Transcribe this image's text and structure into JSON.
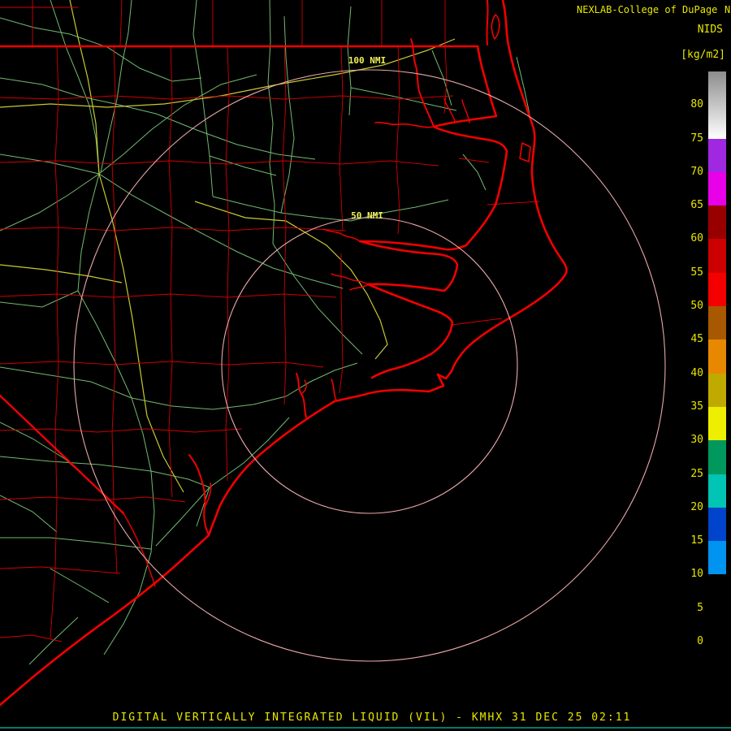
{
  "header": {
    "brand": "NEXLAB-College of DuPage",
    "brand_clip": "N",
    "scale_title": "NIDS",
    "scale_units": "[kg/m2]"
  },
  "range_rings": [
    {
      "label": "100 NMI"
    },
    {
      "label": "50 NMI"
    }
  ],
  "colorbar": {
    "min_value": 0,
    "max_value": 85,
    "tick_step": 5,
    "tick_labels": [
      "80",
      "75",
      "70",
      "65",
      "60",
      "55",
      "50",
      "45",
      "40",
      "35",
      "30",
      "25",
      "20",
      "15",
      "10",
      "5",
      "0"
    ],
    "segments": [
      {
        "from": 75,
        "to": 85,
        "color": "#8c8c8c",
        "color2": "#ffffff"
      },
      {
        "from": 70,
        "to": 75,
        "color": "#a028e0"
      },
      {
        "from": 65,
        "to": 70,
        "color": "#e800e8"
      },
      {
        "from": 60,
        "to": 65,
        "color": "#980000"
      },
      {
        "from": 55,
        "to": 60,
        "color": "#cc0000"
      },
      {
        "from": 50,
        "to": 55,
        "color": "#f40000"
      },
      {
        "from": 45,
        "to": 50,
        "color": "#a85800"
      },
      {
        "from": 40,
        "to": 45,
        "color": "#e88800"
      },
      {
        "from": 35,
        "to": 40,
        "color": "#c0aa00"
      },
      {
        "from": 30,
        "to": 35,
        "color": "#eeee00"
      },
      {
        "from": 25,
        "to": 30,
        "color": "#00985c"
      },
      {
        "from": 20,
        "to": 25,
        "color": "#00c4b4"
      },
      {
        "from": 15,
        "to": 20,
        "color": "#0044cc"
      },
      {
        "from": 10,
        "to": 15,
        "color": "#0094f0"
      },
      {
        "from": 5,
        "to": 10,
        "color": "#000000"
      },
      {
        "from": 0,
        "to": 5,
        "color": "#000000"
      }
    ]
  },
  "footer": {
    "product_line": "DIGITAL VERTICALLY INTEGRATED LIQUID (VIL) - KMHX 31 DEC 25 02:11"
  },
  "colors": {
    "background": "#000000",
    "coastline_red": "#f20000",
    "county_red": "#e00000",
    "road_green": "#7ecf7e",
    "highway_yellow": "#c8c832",
    "range_ring_pink": "#e8a8a8",
    "text_yellow": "#e8e800",
    "bottom_rule_teal": "#007a6a"
  }
}
